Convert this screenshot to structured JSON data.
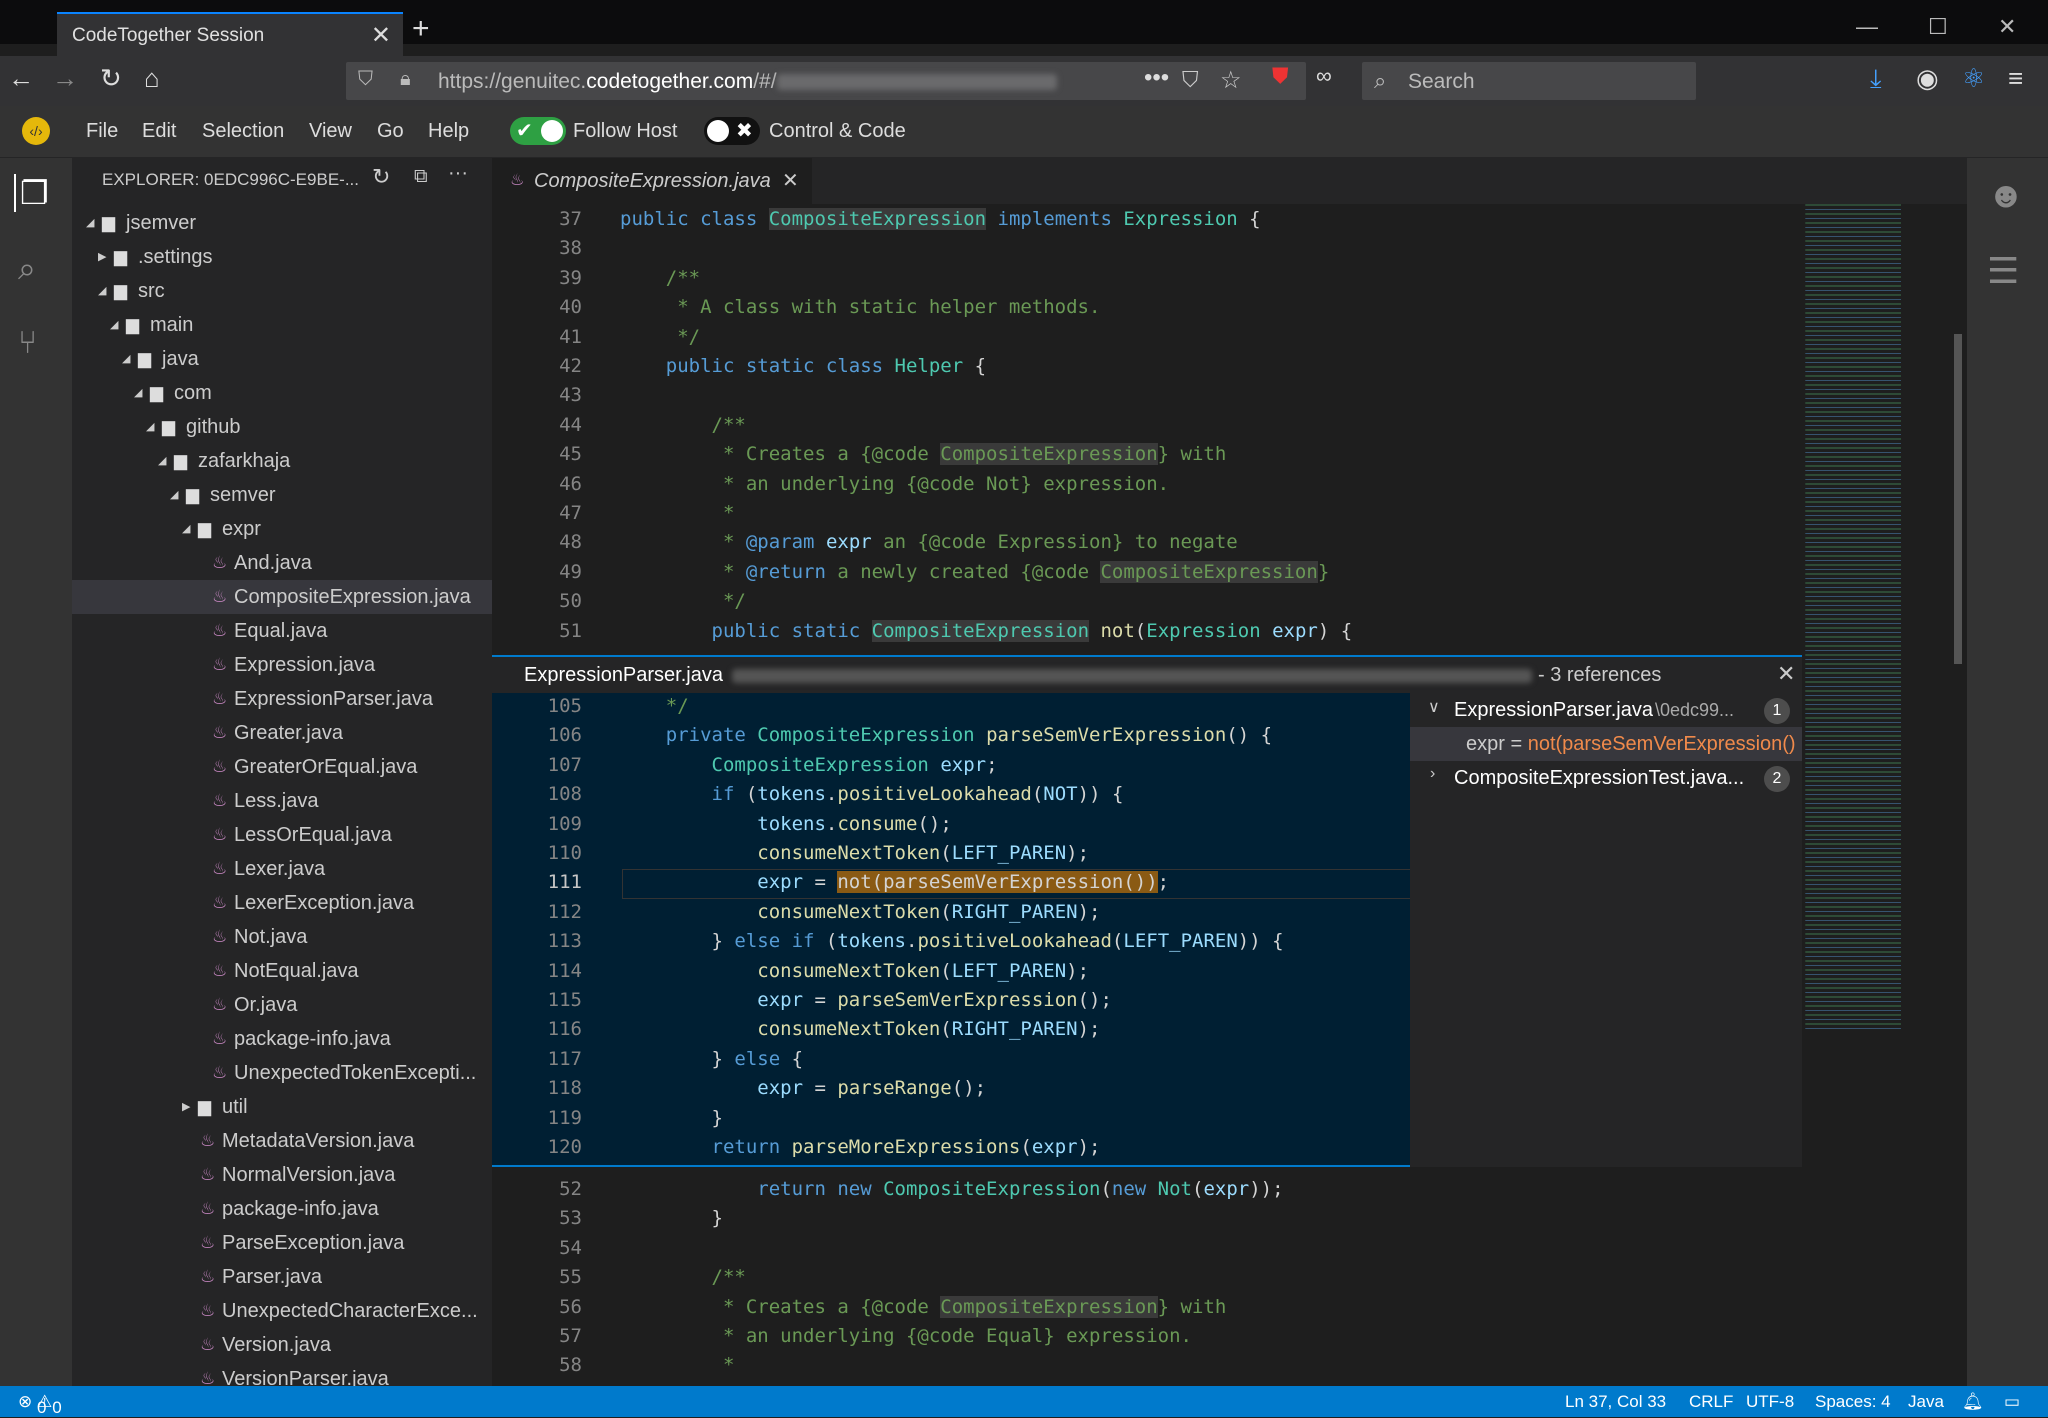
{
  "browser": {
    "tab_title": "CodeTogether Session",
    "url_prefix": "https://genuitec.",
    "url_domain": "codetogether.com",
    "url_path": "/#/",
    "search_placeholder": "Search"
  },
  "menubar": {
    "items": [
      "File",
      "Edit",
      "Selection",
      "View",
      "Go",
      "Help"
    ],
    "follow_host": "Follow Host",
    "control_code": "Control & Code"
  },
  "explorer": {
    "header": "EXPLORER: 0EDC996C-E9BE-...",
    "tree": [
      {
        "label": "jsemver",
        "type": "folder",
        "depth": 0,
        "open": true
      },
      {
        "label": ".settings",
        "type": "folder",
        "depth": 1,
        "open": false
      },
      {
        "label": "src",
        "type": "folder",
        "depth": 1,
        "open": true
      },
      {
        "label": "main",
        "type": "folder",
        "depth": 2,
        "open": true
      },
      {
        "label": "java",
        "type": "folder",
        "depth": 3,
        "open": true
      },
      {
        "label": "com",
        "type": "folder",
        "depth": 4,
        "open": true
      },
      {
        "label": "github",
        "type": "folder",
        "depth": 5,
        "open": true
      },
      {
        "label": "zafarkhaja",
        "type": "folder",
        "depth": 6,
        "open": true
      },
      {
        "label": "semver",
        "type": "folder",
        "depth": 7,
        "open": true
      },
      {
        "label": "expr",
        "type": "folder",
        "depth": 8,
        "open": true
      },
      {
        "label": "And.java",
        "type": "file",
        "depth": 9
      },
      {
        "label": "CompositeExpression.java",
        "type": "file",
        "depth": 9,
        "selected": true
      },
      {
        "label": "Equal.java",
        "type": "file",
        "depth": 9
      },
      {
        "label": "Expression.java",
        "type": "file",
        "depth": 9
      },
      {
        "label": "ExpressionParser.java",
        "type": "file",
        "depth": 9
      },
      {
        "label": "Greater.java",
        "type": "file",
        "depth": 9
      },
      {
        "label": "GreaterOrEqual.java",
        "type": "file",
        "depth": 9
      },
      {
        "label": "Less.java",
        "type": "file",
        "depth": 9
      },
      {
        "label": "LessOrEqual.java",
        "type": "file",
        "depth": 9
      },
      {
        "label": "Lexer.java",
        "type": "file",
        "depth": 9
      },
      {
        "label": "LexerException.java",
        "type": "file",
        "depth": 9
      },
      {
        "label": "Not.java",
        "type": "file",
        "depth": 9
      },
      {
        "label": "NotEqual.java",
        "type": "file",
        "depth": 9
      },
      {
        "label": "Or.java",
        "type": "file",
        "depth": 9
      },
      {
        "label": "package-info.java",
        "type": "file",
        "depth": 9
      },
      {
        "label": "UnexpectedTokenExcepti...",
        "type": "file",
        "depth": 9
      },
      {
        "label": "util",
        "type": "folder",
        "depth": 8,
        "open": false
      },
      {
        "label": "MetadataVersion.java",
        "type": "file",
        "depth": 8
      },
      {
        "label": "NormalVersion.java",
        "type": "file",
        "depth": 8
      },
      {
        "label": "package-info.java",
        "type": "file",
        "depth": 8
      },
      {
        "label": "ParseException.java",
        "type": "file",
        "depth": 8
      },
      {
        "label": "Parser.java",
        "type": "file",
        "depth": 8
      },
      {
        "label": "UnexpectedCharacterExce...",
        "type": "file",
        "depth": 8
      },
      {
        "label": "Version.java",
        "type": "file",
        "depth": 8
      },
      {
        "label": "VersionParser.java",
        "type": "file",
        "depth": 8
      }
    ]
  },
  "editor": {
    "tab": "CompositeExpression.java",
    "top_lines": [
      {
        "n": "37",
        "tokens": [
          [
            "kw",
            "public class "
          ],
          [
            "tyh",
            "CompositeExpression"
          ],
          [
            "kw",
            " implements "
          ],
          [
            "ty",
            "Expression"
          ],
          [
            "p",
            " {"
          ]
        ]
      },
      {
        "n": "38",
        "tokens": []
      },
      {
        "n": "39",
        "tokens": [
          [
            "cm",
            "    /**"
          ]
        ]
      },
      {
        "n": "40",
        "tokens": [
          [
            "cm",
            "     * A class with static helper methods."
          ]
        ]
      },
      {
        "n": "41",
        "tokens": [
          [
            "cm",
            "     */"
          ]
        ]
      },
      {
        "n": "42",
        "tokens": [
          [
            "kw",
            "    public static class "
          ],
          [
            "ty",
            "Helper"
          ],
          [
            "p",
            " {"
          ]
        ]
      },
      {
        "n": "43",
        "tokens": []
      },
      {
        "n": "44",
        "tokens": [
          [
            "cm",
            "        /**"
          ]
        ]
      },
      {
        "n": "45",
        "tokens": [
          [
            "cm",
            "         * Creates a {@code "
          ],
          [
            "cmh",
            "CompositeExpression"
          ],
          [
            "cm",
            "} with"
          ]
        ]
      },
      {
        "n": "46",
        "tokens": [
          [
            "cm",
            "         * an underlying {@code Not} expression."
          ]
        ]
      },
      {
        "n": "47",
        "tokens": [
          [
            "cm",
            "         *"
          ]
        ]
      },
      {
        "n": "48",
        "tokens": [
          [
            "cm",
            "         * "
          ],
          [
            "kw",
            "@param"
          ],
          [
            "cm",
            " "
          ],
          [
            "va",
            "expr"
          ],
          [
            "cm",
            " an {@code Expression} to negate"
          ]
        ]
      },
      {
        "n": "49",
        "tokens": [
          [
            "cm",
            "         * "
          ],
          [
            "kw",
            "@return"
          ],
          [
            "cm",
            " a newly created {@code "
          ],
          [
            "cmh",
            "CompositeExpression"
          ],
          [
            "cm",
            "}"
          ]
        ]
      },
      {
        "n": "50",
        "tokens": [
          [
            "cm",
            "         */"
          ]
        ]
      },
      {
        "n": "51",
        "tokens": [
          [
            "kw",
            "        public static "
          ],
          [
            "tyh",
            "CompositeExpression"
          ],
          [
            "p",
            " "
          ],
          [
            "fn",
            "not"
          ],
          [
            "p",
            "("
          ],
          [
            "ty",
            "Expression"
          ],
          [
            "p",
            " "
          ],
          [
            "va",
            "expr"
          ],
          [
            "p",
            ") {"
          ]
        ]
      }
    ],
    "bottom_lines": [
      {
        "n": "52",
        "tokens": [
          [
            "kw",
            "            return new "
          ],
          [
            "ty",
            "CompositeExpression"
          ],
          [
            "p",
            "("
          ],
          [
            "kw",
            "new "
          ],
          [
            "ty",
            "Not"
          ],
          [
            "p",
            "("
          ],
          [
            "va",
            "expr"
          ],
          [
            "p",
            "));"
          ]
        ]
      },
      {
        "n": "53",
        "tokens": [
          [
            "p",
            "        }"
          ]
        ]
      },
      {
        "n": "54",
        "tokens": []
      },
      {
        "n": "55",
        "tokens": [
          [
            "cm",
            "        /**"
          ]
        ]
      },
      {
        "n": "56",
        "tokens": [
          [
            "cm",
            "         * Creates a {@code "
          ],
          [
            "cmh",
            "CompositeExpression"
          ],
          [
            "cm",
            "} with"
          ]
        ]
      },
      {
        "n": "57",
        "tokens": [
          [
            "cm",
            "         * an underlying {@code Equal} expression."
          ]
        ]
      },
      {
        "n": "58",
        "tokens": [
          [
            "cm",
            "         *"
          ]
        ]
      }
    ]
  },
  "peek": {
    "file": "ExpressionParser.java",
    "refs_label": "- 3 references",
    "lines": [
      {
        "n": "105",
        "tokens": [
          [
            "cm",
            "    */"
          ]
        ]
      },
      {
        "n": "106",
        "tokens": [
          [
            "kw",
            "    private "
          ],
          [
            "ty",
            "CompositeExpression"
          ],
          [
            "p",
            " "
          ],
          [
            "fn",
            "parseSemVerExpression"
          ],
          [
            "p",
            "() {"
          ]
        ]
      },
      {
        "n": "107",
        "tokens": [
          [
            "ty",
            "        CompositeExpression"
          ],
          [
            "p",
            " "
          ],
          [
            "va",
            "expr"
          ],
          [
            "p",
            ";"
          ]
        ]
      },
      {
        "n": "108",
        "tokens": [
          [
            "kw",
            "        if"
          ],
          [
            "p",
            " ("
          ],
          [
            "va",
            "tokens"
          ],
          [
            "p",
            "."
          ],
          [
            "fn",
            "positiveLookahead"
          ],
          [
            "p",
            "("
          ],
          [
            "va",
            "NOT"
          ],
          [
            "p",
            ")) {"
          ]
        ]
      },
      {
        "n": "109",
        "tokens": [
          [
            "va",
            "            tokens"
          ],
          [
            "p",
            "."
          ],
          [
            "fn",
            "consume"
          ],
          [
            "p",
            "();"
          ]
        ]
      },
      {
        "n": "110",
        "tokens": [
          [
            "fn",
            "            consumeNextToken"
          ],
          [
            "p",
            "("
          ],
          [
            "va",
            "LEFT_PAREN"
          ],
          [
            "p",
            ");"
          ]
        ]
      },
      {
        "n": "111",
        "tokens": [
          [
            "va",
            "            expr"
          ],
          [
            "p",
            " = "
          ],
          [
            "hlo",
            "not(parseSemVerExpression())"
          ],
          [
            "p",
            ";"
          ]
        ]
      },
      {
        "n": "112",
        "tokens": [
          [
            "fn",
            "            consumeNextToken"
          ],
          [
            "p",
            "("
          ],
          [
            "va",
            "RIGHT_PAREN"
          ],
          [
            "p",
            ");"
          ]
        ]
      },
      {
        "n": "113",
        "tokens": [
          [
            "p",
            "        } "
          ],
          [
            "kw",
            "else if"
          ],
          [
            "p",
            " ("
          ],
          [
            "va",
            "tokens"
          ],
          [
            "p",
            "."
          ],
          [
            "fn",
            "positiveLookahead"
          ],
          [
            "p",
            "("
          ],
          [
            "va",
            "LEFT_PAREN"
          ],
          [
            "p",
            ")) {"
          ]
        ]
      },
      {
        "n": "114",
        "tokens": [
          [
            "fn",
            "            consumeNextToken"
          ],
          [
            "p",
            "("
          ],
          [
            "va",
            "LEFT_PAREN"
          ],
          [
            "p",
            ");"
          ]
        ]
      },
      {
        "n": "115",
        "tokens": [
          [
            "va",
            "            expr"
          ],
          [
            "p",
            " = "
          ],
          [
            "fn",
            "parseSemVerExpression"
          ],
          [
            "p",
            "();"
          ]
        ]
      },
      {
        "n": "116",
        "tokens": [
          [
            "fn",
            "            consumeNextToken"
          ],
          [
            "p",
            "("
          ],
          [
            "va",
            "RIGHT_PAREN"
          ],
          [
            "p",
            ");"
          ]
        ]
      },
      {
        "n": "117",
        "tokens": [
          [
            "p",
            "        } "
          ],
          [
            "kw",
            "else"
          ],
          [
            "p",
            " {"
          ]
        ]
      },
      {
        "n": "118",
        "tokens": [
          [
            "va",
            "            expr"
          ],
          [
            "p",
            " = "
          ],
          [
            "fn",
            "parseRange"
          ],
          [
            "p",
            "();"
          ]
        ]
      },
      {
        "n": "119",
        "tokens": [
          [
            "p",
            "        }"
          ]
        ]
      },
      {
        "n": "120",
        "tokens": [
          [
            "kw",
            "        return "
          ],
          [
            "fn",
            "parseMoreExpressions"
          ],
          [
            "p",
            "("
          ],
          [
            "va",
            "expr"
          ],
          [
            "p",
            ");"
          ]
        ]
      }
    ],
    "ref_groups": [
      {
        "file": "ExpressionParser.java",
        "path": "\\0edc99...",
        "count": "1",
        "expanded": true,
        "preview_pre": "expr = ",
        "preview_match": "not(parseSemVerExpression()"
      },
      {
        "file": "CompositeExpressionTest.java...",
        "path": "",
        "count": "2",
        "expanded": false
      }
    ]
  },
  "status": {
    "errors": "0",
    "warnings": "0",
    "position": "Ln 37, Col 33",
    "eol": "CRLF",
    "encoding": "UTF-8",
    "spaces": "Spaces: 4",
    "language": "Java"
  }
}
